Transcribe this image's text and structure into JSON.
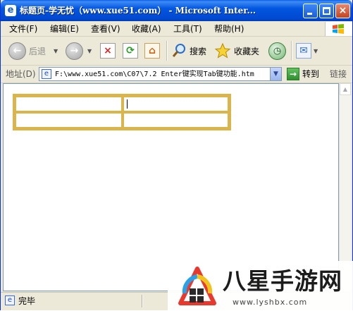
{
  "window": {
    "title": "标题页-学无忧（www.xue51.com） - Microsoft Inter...",
    "app_icon_glyph": "e",
    "buttons": {
      "minimize": "minimize",
      "maximize": "maximize",
      "close": "×"
    }
  },
  "menu": {
    "items": [
      {
        "label": "文件(F)"
      },
      {
        "label": "编辑(E)"
      },
      {
        "label": "查看(V)"
      },
      {
        "label": "收藏(A)"
      },
      {
        "label": "工具(T)"
      },
      {
        "label": "帮助(H)"
      }
    ]
  },
  "toolbar": {
    "back_label": "后退",
    "back_glyph": "←",
    "forward_glyph": "→",
    "stop_glyph": "×",
    "refresh_glyph": "⟳",
    "home_glyph": "⌂",
    "search_label": "搜索",
    "favorites_label": "收藏夹",
    "history_glyph": "◷",
    "mail_glyph": "✉"
  },
  "address": {
    "label": "地址(D)",
    "value": "F:\\www.xue51.com\\C07\\7.2  Enter键实现Tab键功能.htm",
    "go_label": "转到",
    "go_glyph": "→",
    "links_label": "链接"
  },
  "page": {
    "table": {
      "rows": [
        [
          "",
          ""
        ],
        [
          "",
          ""
        ]
      ]
    }
  },
  "status": {
    "text": "完毕"
  },
  "watermark": {
    "title": "八星手游网",
    "url": "www.lyshbx.com"
  },
  "colors": {
    "titlebar": "#0256e0",
    "table_border": "#d9b54b",
    "chrome": "#ece9d8"
  }
}
